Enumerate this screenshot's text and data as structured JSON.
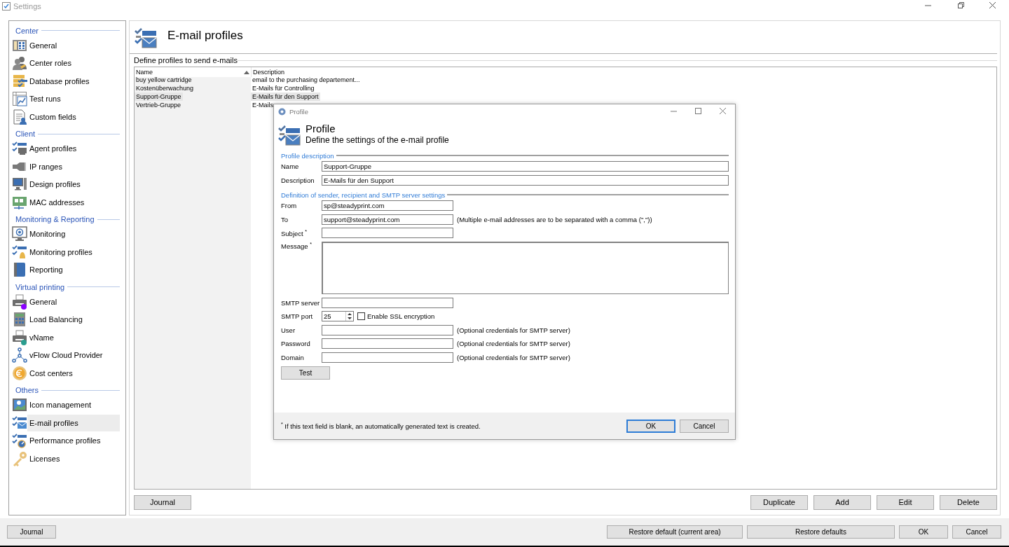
{
  "window": {
    "title": "Settings"
  },
  "sidebar": {
    "sections": [
      {
        "title": "Center",
        "items": [
          {
            "label": "General",
            "selected": false
          },
          {
            "label": "Center roles",
            "selected": false
          },
          {
            "label": "Database profiles",
            "selected": false
          },
          {
            "label": "Test runs",
            "selected": false
          },
          {
            "label": "Custom fields",
            "selected": false
          }
        ]
      },
      {
        "title": "Client",
        "items": [
          {
            "label": "Agent profiles",
            "selected": false
          },
          {
            "label": "IP ranges",
            "selected": false
          },
          {
            "label": "Design profiles",
            "selected": false
          },
          {
            "label": "MAC addresses",
            "selected": false
          }
        ]
      },
      {
        "title": "Monitoring & Reporting",
        "items": [
          {
            "label": "Monitoring",
            "selected": false
          },
          {
            "label": "Monitoring profiles",
            "selected": false
          },
          {
            "label": "Reporting",
            "selected": false
          }
        ]
      },
      {
        "title": "Virtual printing",
        "items": [
          {
            "label": "General",
            "selected": false
          },
          {
            "label": "Load Balancing",
            "selected": false
          },
          {
            "label": "vName",
            "selected": false
          },
          {
            "label": "vFlow Cloud Provider",
            "selected": false
          },
          {
            "label": "Cost centers",
            "selected": false
          }
        ]
      },
      {
        "title": "Others",
        "items": [
          {
            "label": "Icon management",
            "selected": false
          },
          {
            "label": "E-mail profiles",
            "selected": true
          },
          {
            "label": "Performance profiles",
            "selected": false
          },
          {
            "label": "Licenses",
            "selected": false
          }
        ]
      }
    ]
  },
  "page": {
    "title": "E-mail profiles",
    "group_title": "Define profiles to send e-mails",
    "table": {
      "columns": [
        {
          "label": "Name",
          "sorted": true
        },
        {
          "label": "Description",
          "sorted": false
        }
      ],
      "rows": [
        {
          "name": "buy yellow cartridge",
          "description": "email to the purchasing departement...",
          "selected": false
        },
        {
          "name": "Kostenüberwachung",
          "description": "E-Mails für Controlling",
          "selected": false
        },
        {
          "name": "Support-Gruppe",
          "description": "E-Mails für den Support",
          "selected": true
        },
        {
          "name": "Vertrieb-Gruppe",
          "description": "E-Mails",
          "selected": false
        }
      ]
    },
    "left_buttons": [
      "Journal"
    ],
    "right_buttons": [
      "Duplicate",
      "Add",
      "Edit",
      "Delete"
    ]
  },
  "footer": {
    "left_buttons": [
      "Journal"
    ],
    "right_buttons": [
      "Restore default (current area)",
      "Restore defaults",
      "OK",
      "Cancel"
    ]
  },
  "dialog": {
    "title": "Profile",
    "heading": "Profile",
    "subtitle": "Define the settings of the e-mail profile",
    "sections": [
      {
        "title": "Profile description",
        "fields": [
          {
            "kind": "wide_text",
            "label": "Name",
            "value": "Support-Gruppe"
          },
          {
            "kind": "wide_text",
            "label": "Description",
            "value": "E-Mails für den Support"
          }
        ]
      },
      {
        "title": "Definition of sender, recipient and SMTP server settings",
        "fields": [
          {
            "kind": "text",
            "label": "From",
            "value": "sp@steadyprint.com"
          },
          {
            "kind": "text",
            "label": "To",
            "value": "support@steadyprint.com",
            "hint": "(Multiple e-mail addresses are to be separated with a comma (\",\"))"
          },
          {
            "kind": "text",
            "label": "Subject $^{*}$"
          },
          {
            "kind": "textarea",
            "label": "Message $^{*}$"
          },
          {
            "kind": "text",
            "label": "SMTP server"
          },
          {
            "kind": "spinner",
            "label": "SMTP port",
            "value": "25",
            "checkbox": {
              "label": "Enable SSL encryption",
              "checked": false
            }
          },
          {
            "kind": "text",
            "label": "User",
            "hint": "(Optional credentials for SMTP server)"
          },
          {
            "kind": "text",
            "label": "Password",
            "hint": "(Optional credentials for SMTP server)"
          },
          {
            "kind": "text",
            "label": "Domain",
            "hint": "(Optional credentials for SMTP server)"
          }
        ]
      }
    ],
    "test_button": "Test",
    "note": "$^{*}$ If this text field is blank, an automatically generated text is created.",
    "buttons": [
      {
        "label": "OK",
        "default": true
      },
      {
        "label": "Cancel",
        "default": false
      }
    ]
  }
}
